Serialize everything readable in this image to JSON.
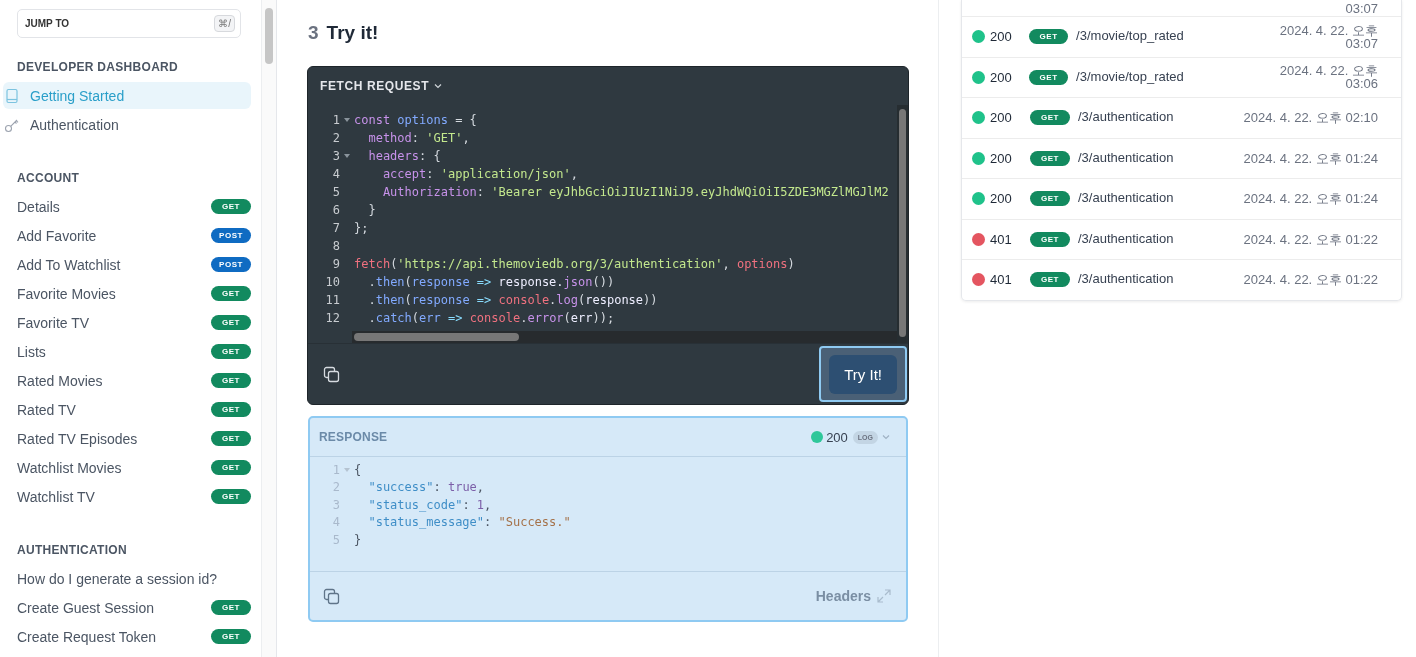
{
  "sidebar": {
    "jump_to": {
      "placeholder": "JUMP TO",
      "shortcut": "⌘/"
    },
    "sections": [
      {
        "title": "DEVELOPER DASHBOARD",
        "items": [
          {
            "label": "Getting Started",
            "selected": true
          },
          {
            "label": "Authentication",
            "selected": false
          }
        ]
      },
      {
        "title": "ACCOUNT",
        "items": [
          {
            "label": "Details",
            "method": "GET",
            "selected": false
          },
          {
            "label": "Add Favorite",
            "method": "POST",
            "selected": false
          },
          {
            "label": "Add To Watchlist",
            "method": "POST",
            "selected": false
          },
          {
            "label": "Favorite Movies",
            "method": "GET",
            "selected": false
          },
          {
            "label": "Favorite TV",
            "method": "GET",
            "selected": false
          },
          {
            "label": "Lists",
            "method": "GET",
            "selected": false
          },
          {
            "label": "Rated Movies",
            "method": "GET",
            "selected": false
          },
          {
            "label": "Rated TV",
            "method": "GET",
            "selected": false
          },
          {
            "label": "Rated TV Episodes",
            "method": "GET",
            "selected": false
          },
          {
            "label": "Watchlist Movies",
            "method": "GET",
            "selected": false
          },
          {
            "label": "Watchlist TV",
            "method": "GET",
            "selected": false
          }
        ]
      },
      {
        "title": "AUTHENTICATION",
        "items": [
          {
            "label": "How do I generate a session id?",
            "selected": false
          },
          {
            "label": "Create Guest Session",
            "method": "GET",
            "selected": false
          },
          {
            "label": "Create Request Token",
            "method": "GET",
            "selected": false
          }
        ]
      }
    ]
  },
  "main": {
    "step": "3",
    "heading": "Try it!",
    "request": {
      "title": "FETCH REQUEST",
      "button": "Try It!",
      "lines": [
        {
          "n": "1",
          "fold": true,
          "tokens": [
            {
              "t": "const ",
              "kind": "kw"
            },
            {
              "t": "options",
              "kind": "var"
            },
            {
              "t": " = {",
              "kind": "punct"
            }
          ]
        },
        {
          "n": "2",
          "fold": false,
          "tokens": [
            {
              "t": "  method",
              "kind": "prop"
            },
            {
              "t": ": ",
              "kind": "punct"
            },
            {
              "t": "'GET'",
              "kind": "str"
            },
            {
              "t": ",",
              "kind": "punct"
            }
          ]
        },
        {
          "n": "3",
          "fold": true,
          "tokens": [
            {
              "t": "  headers",
              "kind": "prop"
            },
            {
              "t": ": {",
              "kind": "punct"
            }
          ]
        },
        {
          "n": "4",
          "fold": false,
          "tokens": [
            {
              "t": "    accept",
              "kind": "prop"
            },
            {
              "t": ": ",
              "kind": "punct"
            },
            {
              "t": "'application/json'",
              "kind": "str"
            },
            {
              "t": ",",
              "kind": "punct"
            }
          ]
        },
        {
          "n": "5",
          "fold": false,
          "tokens": [
            {
              "t": "    Authorization",
              "kind": "prop"
            },
            {
              "t": ": ",
              "kind": "punct"
            },
            {
              "t": "'Bearer eyJhbGciOiJIUzI1NiJ9.eyJhdWQiOiI5ZDE3MGZlMGJlM2",
              "kind": "str"
            }
          ]
        },
        {
          "n": "6",
          "fold": false,
          "tokens": [
            {
              "t": "  }",
              "kind": "punct"
            }
          ]
        },
        {
          "n": "7",
          "fold": false,
          "tokens": [
            {
              "t": "};",
              "kind": "punct"
            }
          ]
        },
        {
          "n": "8",
          "fold": false
        },
        {
          "n": "9",
          "fold": false,
          "tokens": [
            {
              "t": "fetch",
              "kind": "fn"
            },
            {
              "t": "(",
              "kind": "punct"
            },
            {
              "t": "'https://api.themoviedb.org/3/authentication'",
              "kind": "str"
            },
            {
              "t": ", ",
              "kind": "punct"
            },
            {
              "t": "options",
              "kind": "fn"
            },
            {
              "t": ")",
              "kind": "punct"
            }
          ]
        },
        {
          "n": "10",
          "fold": false,
          "tokens": [
            {
              "t": "  .",
              "kind": "punct"
            },
            {
              "t": "then",
              "kind": "var"
            },
            {
              "t": "(",
              "kind": "punct"
            },
            {
              "t": "response",
              "kind": "var"
            },
            {
              "t": " => ",
              "kind": "op"
            },
            {
              "t": "response.",
              "kind": "plain"
            },
            {
              "t": "json",
              "kind": "kw"
            },
            {
              "t": "())",
              "kind": "punct"
            }
          ]
        },
        {
          "n": "11",
          "fold": false,
          "tokens": [
            {
              "t": "  .",
              "kind": "punct"
            },
            {
              "t": "then",
              "kind": "var"
            },
            {
              "t": "(",
              "kind": "punct"
            },
            {
              "t": "response",
              "kind": "var"
            },
            {
              "t": " => ",
              "kind": "op"
            },
            {
              "t": "console",
              "kind": "fn"
            },
            {
              "t": ".",
              "kind": "punct"
            },
            {
              "t": "log",
              "kind": "kw"
            },
            {
              "t": "(",
              "kind": "punct"
            },
            {
              "t": "response",
              "kind": "plain"
            },
            {
              "t": "))",
              "kind": "punct"
            }
          ]
        },
        {
          "n": "12",
          "fold": false,
          "tokens": [
            {
              "t": "  .",
              "kind": "punct"
            },
            {
              "t": "catch",
              "kind": "var"
            },
            {
              "t": "(",
              "kind": "punct"
            },
            {
              "t": "err",
              "kind": "var"
            },
            {
              "t": " => ",
              "kind": "op"
            },
            {
              "t": "console",
              "kind": "fn"
            },
            {
              "t": ".",
              "kind": "punct"
            },
            {
              "t": "error",
              "kind": "kw"
            },
            {
              "t": "(",
              "kind": "punct"
            },
            {
              "t": "err",
              "kind": "plain"
            },
            {
              "t": "));",
              "kind": "punct"
            }
          ]
        }
      ]
    },
    "response": {
      "title": "RESPONSE",
      "status": "200",
      "log": "LOG",
      "footer_link": "Headers",
      "lines": [
        {
          "n": "1",
          "fold": true,
          "tokens": [
            {
              "t": "{",
              "kind": "punct"
            }
          ]
        },
        {
          "n": "2",
          "fold": false,
          "tokens": [
            {
              "t": "  \"success\"",
              "kind": "key"
            },
            {
              "t": ": ",
              "kind": "punct"
            },
            {
              "t": "true",
              "kind": "num"
            },
            {
              "t": ",",
              "kind": "punct"
            }
          ]
        },
        {
          "n": "3",
          "fold": false,
          "tokens": [
            {
              "t": "  \"status_code\"",
              "kind": "key"
            },
            {
              "t": ": ",
              "kind": "punct"
            },
            {
              "t": "1",
              "kind": "num"
            },
            {
              "t": ",",
              "kind": "punct"
            }
          ]
        },
        {
          "n": "4",
          "fold": false,
          "tokens": [
            {
              "t": "  \"status_message\"",
              "kind": "key"
            },
            {
              "t": ": ",
              "kind": "punct"
            },
            {
              "t": "\"Success.\"",
              "kind": "jstr"
            }
          ]
        },
        {
          "n": "5",
          "fold": false,
          "tokens": [
            {
              "t": "}",
              "kind": "punct"
            }
          ]
        }
      ]
    }
  },
  "log": {
    "partial_time": "03:07",
    "rows": [
      {
        "status": "200",
        "color": "#1fc28a",
        "method": "GET",
        "path": "/3/movie/top_rated",
        "time": "2024. 4. 22. 오후 03:07"
      },
      {
        "status": "200",
        "color": "#1fc28a",
        "method": "GET",
        "path": "/3/movie/top_rated",
        "time": "2024. 4. 22. 오후 03:06"
      },
      {
        "status": "200",
        "color": "#1fc28a",
        "method": "GET",
        "path": "/3/authentication",
        "time": "2024. 4. 22. 오후 02:10"
      },
      {
        "status": "200",
        "color": "#1fc28a",
        "method": "GET",
        "path": "/3/authentication",
        "time": "2024. 4. 22. 오후 01:24"
      },
      {
        "status": "200",
        "color": "#1fc28a",
        "method": "GET",
        "path": "/3/authentication",
        "time": "2024. 4. 22. 오후 01:24"
      },
      {
        "status": "401",
        "color": "#e45560",
        "method": "GET",
        "path": "/3/authentication",
        "time": "2024. 4. 22. 오후 01:22"
      },
      {
        "status": "401",
        "color": "#e45560",
        "method": "GET",
        "path": "/3/authentication",
        "time": "2024. 4. 22. 오후 01:22"
      }
    ]
  }
}
